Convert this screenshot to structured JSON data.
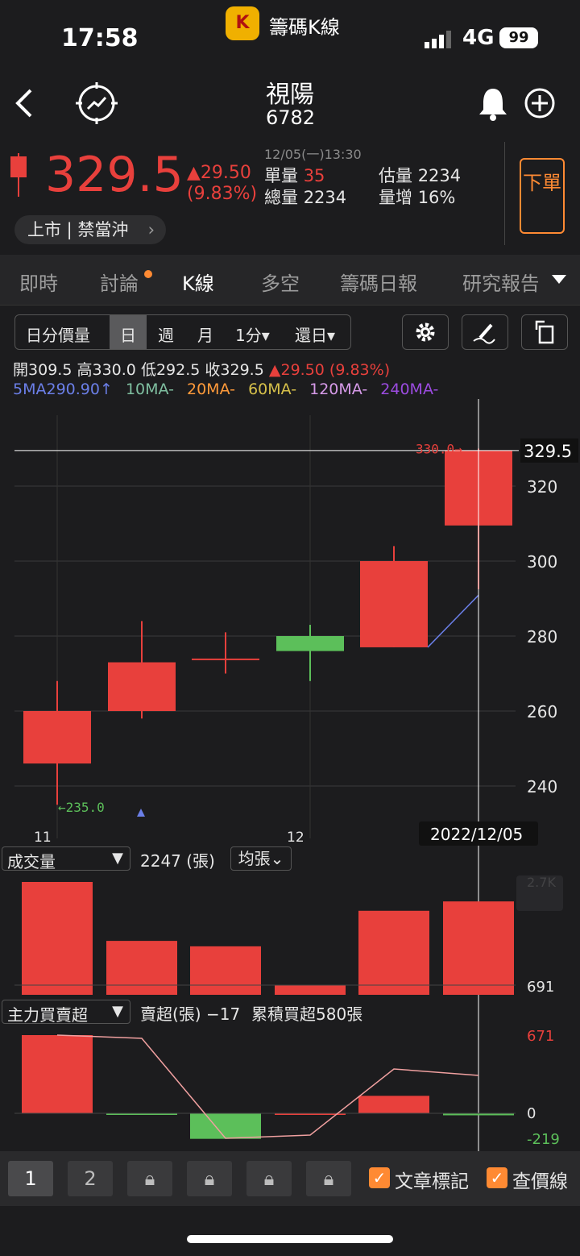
{
  "status": {
    "time": "17:58",
    "app": "籌碼K線",
    "network": "4G",
    "battery": "99"
  },
  "stock": {
    "name": "視陽",
    "code": "6782",
    "price": "329.5",
    "change": "▲29.50",
    "change_pct": "(9.83%)",
    "datetime": "12/05(一)13:30",
    "single_vol_label": "單量",
    "single_vol": "35",
    "total_vol_label": "總量",
    "total_vol": "2234",
    "est_vol_label": "估量",
    "est_vol": "2234",
    "vol_inc_label": "量增",
    "vol_inc": "16%",
    "tag": "上市 | 禁當沖",
    "order_label": "下單"
  },
  "tabs": [
    "即時",
    "討論",
    "K線",
    "多空",
    "籌碼日報",
    "研究報告"
  ],
  "toolbar": {
    "btn1": "日分價量",
    "btn2": "日",
    "btn3": "週",
    "btn4": "月",
    "btn5": "1分▾",
    "btn6": "還日▾"
  },
  "ohlc": {
    "open_label": "開",
    "open": "309.5",
    "high_label": "高",
    "high": "330.0",
    "low_label": "低",
    "low": "292.5",
    "close_label": "收",
    "close": "329.5",
    "change": "▲29.50 (9.83%)"
  },
  "ma": {
    "ma5": "5MA290.90↑",
    "ma10": "10MA-",
    "ma20": "20MA-",
    "ma60": "60MA-",
    "ma120": "120MA-",
    "ma240": "240MA-"
  },
  "colors": {
    "up": "#e8403c",
    "down": "#5cbf5a",
    "ma5": "#6b7fe8",
    "ma10": "#7fbfa0",
    "ma20": "#ff9a3a",
    "ma60": "#d6c04a",
    "ma120": "#d69ae8",
    "ma240": "#9b4be0",
    "accent": "#ff8a33"
  },
  "chart_data": [
    {
      "type": "candlestick",
      "x_labels": [
        "11",
        "12"
      ],
      "crosshair_date": "2022/12/05",
      "price_tag": "330.0→",
      "low_tag": "←235.0",
      "last_price_label": "329.5",
      "y_ticks": [
        "320",
        "300",
        "280",
        "260",
        "240"
      ],
      "candles": [
        {
          "open": 260,
          "high": 268,
          "low": 235,
          "close": 246
        },
        {
          "open": 260,
          "high": 284,
          "low": 258,
          "close": 273
        },
        {
          "open": 274,
          "high": 281,
          "low": 270,
          "close": 274
        },
        {
          "open": 280,
          "high": 283,
          "low": 268,
          "close": 276
        },
        {
          "open": 277,
          "high": 304,
          "low": 277,
          "close": 300
        },
        {
          "open": 309.5,
          "high": 330,
          "low": 292.5,
          "close": 329.5
        }
      ],
      "ma5": [
        null,
        null,
        null,
        null,
        277,
        290.9
      ]
    },
    {
      "type": "bar",
      "title": "成交量",
      "value_text": "2247 (張)",
      "avg_label": "均張⌄",
      "scale_label": "2.7K",
      "right_label": "691",
      "values": [
        2700,
        1290,
        1160,
        240,
        2010,
        2234
      ]
    },
    {
      "type": "bar",
      "title": "主力買賣超",
      "value_text": "賣超(張) −17",
      "cum_text": "累積買超580張",
      "y_ticks": [
        "671",
        "0",
        "-219"
      ],
      "values": [
        671,
        -5,
        -219,
        0,
        150,
        -17
      ],
      "cumulative": [
        671,
        666,
        -219,
        -200,
        380,
        350
      ]
    }
  ],
  "bottom": {
    "pages": [
      "1",
      "2"
    ],
    "check1": "文章標記",
    "check2": "查價線"
  }
}
